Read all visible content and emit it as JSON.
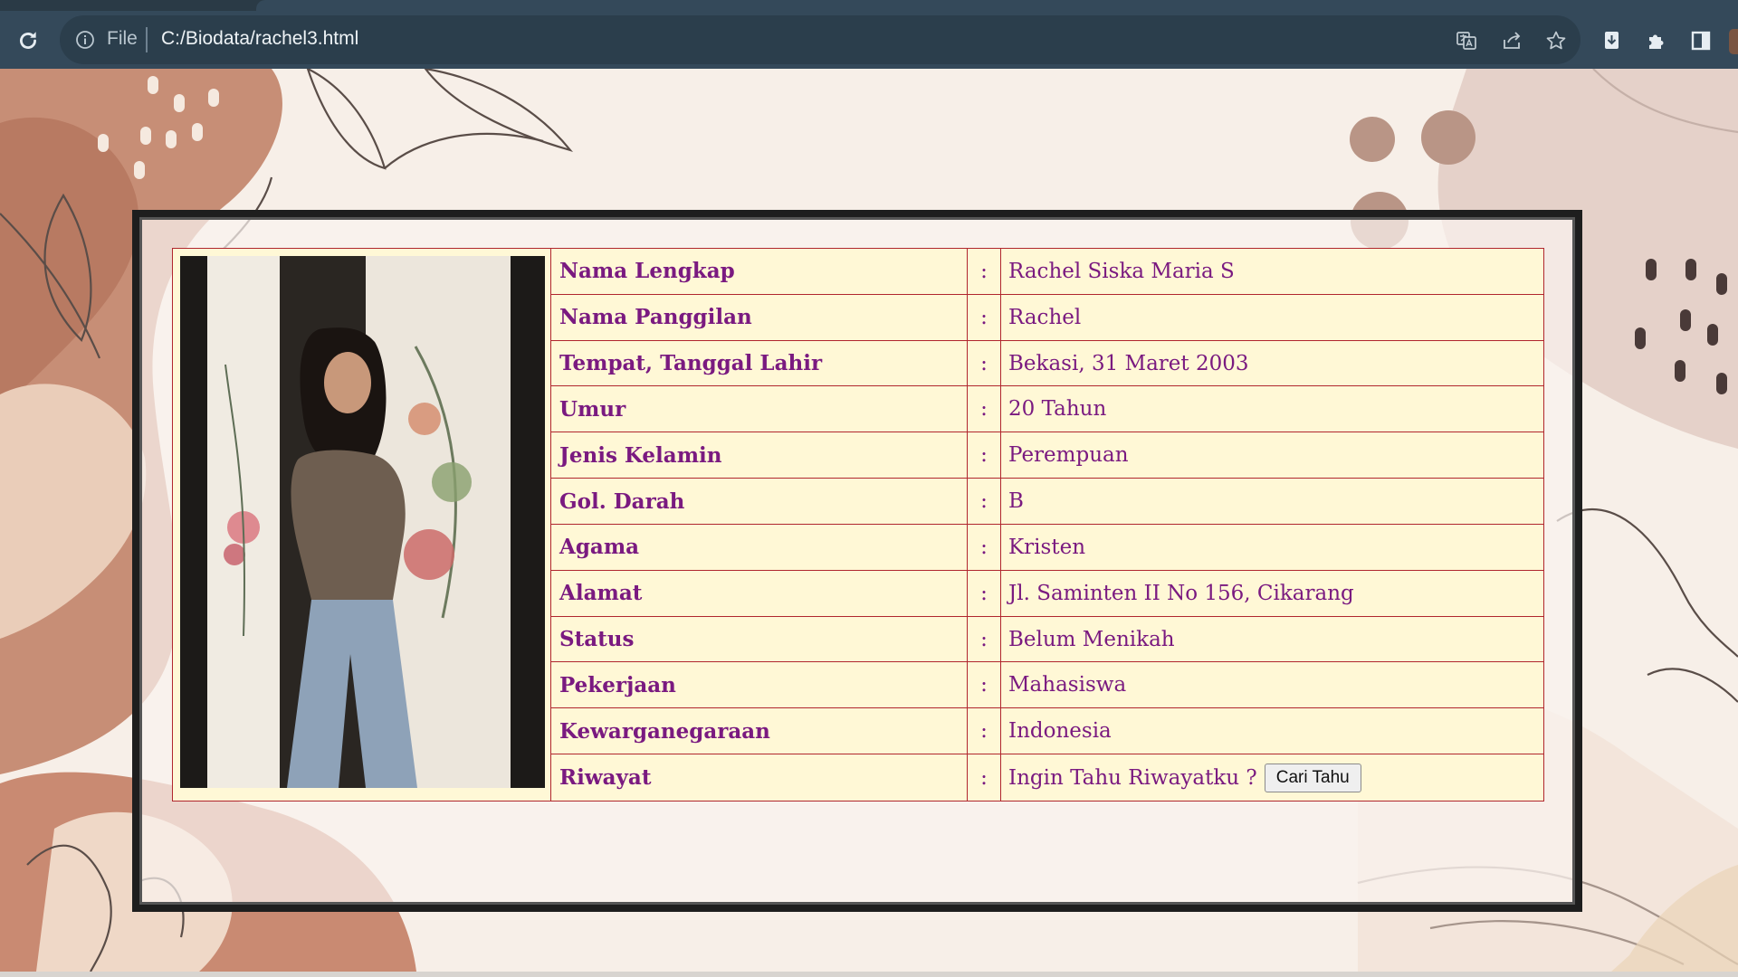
{
  "browser": {
    "file_label": "File",
    "url": "C:/Biodata/rachel3.html"
  },
  "icons": [
    "reload-icon",
    "info-icon",
    "translate-icon",
    "share-icon",
    "bookmark-star-icon",
    "extension-icon",
    "puzzle-extensions-icon",
    "side-panel-icon"
  ],
  "biodata": {
    "rows": [
      {
        "label": "Nama Lengkap",
        "value": "Rachel Siska Maria S"
      },
      {
        "label": "Nama Panggilan",
        "value": "Rachel"
      },
      {
        "label": "Tempat, Tanggal Lahir",
        "value": "Bekasi, 31 Maret 2003"
      },
      {
        "label": "Umur",
        "value": "20 Tahun"
      },
      {
        "label": "Jenis Kelamin",
        "value": "Perempuan"
      },
      {
        "label": "Gol. Darah",
        "value": "B"
      },
      {
        "label": "Agama",
        "value": "Kristen"
      },
      {
        "label": "Alamat",
        "value": "Jl. Saminten II No 156, Cikarang"
      },
      {
        "label": "Status",
        "value": "Belum Menikah"
      },
      {
        "label": "Pekerjaan",
        "value": "Mahasiswa"
      },
      {
        "label": "Kewarganegaraan",
        "value": "Indonesia"
      },
      {
        "label": "Riwayat",
        "value": "Ingin Tahu Riwayatku ?"
      }
    ],
    "colon": ":",
    "button_label": "Cari Tahu"
  },
  "colors": {
    "label_text": "#7a1a80",
    "table_bg": "#fff8d6",
    "table_border": "#b0262e",
    "frame": "#1e1e1e",
    "toolbar": "#34495a"
  }
}
